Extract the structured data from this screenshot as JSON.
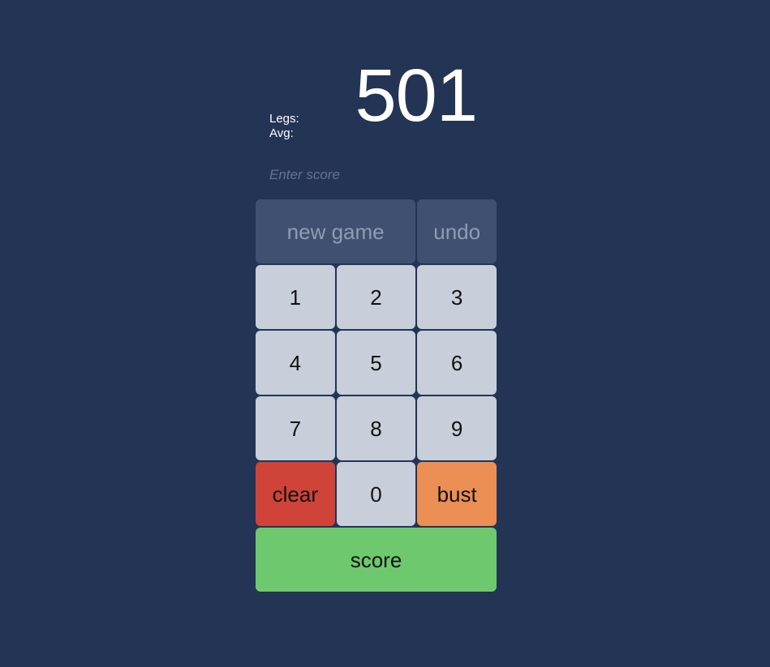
{
  "app": {
    "background_color": "#233455"
  },
  "scoreboard": {
    "current_score": "501",
    "stats": [
      {
        "label": "Legs:",
        "value": ""
      },
      {
        "label": "Avg:",
        "value": ""
      }
    ]
  },
  "score_entry": {
    "value": "",
    "placeholder": "Enter score"
  },
  "keypad": {
    "rows": [
      [
        {
          "name": "new-game",
          "label": "new game",
          "style": "util",
          "span": 2
        },
        {
          "name": "undo",
          "label": "undo",
          "style": "util",
          "span": 1
        }
      ],
      [
        {
          "name": "digit-1",
          "label": "1",
          "style": "digit",
          "span": 1
        },
        {
          "name": "digit-2",
          "label": "2",
          "style": "digit",
          "span": 1
        },
        {
          "name": "digit-3",
          "label": "3",
          "style": "digit",
          "span": 1
        }
      ],
      [
        {
          "name": "digit-4",
          "label": "4",
          "style": "digit",
          "span": 1
        },
        {
          "name": "digit-5",
          "label": "5",
          "style": "digit",
          "span": 1
        },
        {
          "name": "digit-6",
          "label": "6",
          "style": "digit",
          "span": 1
        }
      ],
      [
        {
          "name": "digit-7",
          "label": "7",
          "style": "digit",
          "span": 1
        },
        {
          "name": "digit-8",
          "label": "8",
          "style": "digit",
          "span": 1
        },
        {
          "name": "digit-9",
          "label": "9",
          "style": "digit",
          "span": 1
        }
      ],
      [
        {
          "name": "clear",
          "label": "clear",
          "style": "danger",
          "span": 1
        },
        {
          "name": "digit-0",
          "label": "0",
          "style": "digit",
          "span": 1
        },
        {
          "name": "bust",
          "label": "bust",
          "style": "warn",
          "span": 1
        }
      ],
      [
        {
          "name": "score-submit",
          "label": "score",
          "style": "success",
          "span": 3
        }
      ]
    ]
  },
  "colors": {
    "background": "#233455",
    "key_default": "#c8cfda",
    "key_disabled": "#3f5070",
    "key_disabled_text": "#8f9cb3",
    "clear_red": "#cf4338",
    "bust_orange": "#eb8f55",
    "score_green": "#6ec96e",
    "score_text": "#ffffff",
    "placeholder": "#66738c"
  }
}
